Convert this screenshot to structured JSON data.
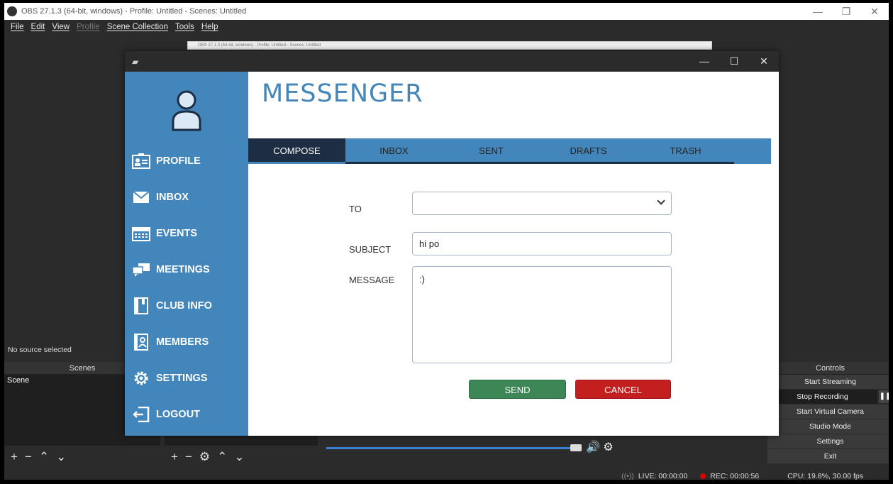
{
  "obs": {
    "title": "OBS 27.1.3 (64-bit, windows) - Profile: Untitled - Scenes: Untitled",
    "inner_title": "OBS 27.1.3 (64-bit, windows) - Profile: Untitled - Scenes: Untitled",
    "menu": [
      "File",
      "Edit",
      "View",
      "Profile",
      "Scene Collection",
      "Tools",
      "Help"
    ],
    "no_source": "No source selected",
    "scenes_header": "Scenes",
    "scene_item": "Scene",
    "controls_header": "Controls",
    "controls": [
      "Start Streaming",
      "Stop Recording",
      "Start Virtual Camera",
      "Studio Mode",
      "Settings",
      "Exit"
    ],
    "status": {
      "live": "LIVE: 00:00:00",
      "rec": "REC: 00:00:56",
      "cpu": "CPU: 19.8%, 30.00 fps"
    }
  },
  "messenger": {
    "heading": "MESSENGER",
    "nav": [
      {
        "label": "PROFILE",
        "icon": "profile-card-icon"
      },
      {
        "label": "INBOX",
        "icon": "envelope-icon"
      },
      {
        "label": "EVENTS",
        "icon": "calendar-icon"
      },
      {
        "label": "MEETINGS",
        "icon": "chat-bubbles-icon"
      },
      {
        "label": "CLUB INFO",
        "icon": "book-icon"
      },
      {
        "label": "MEMBERS",
        "icon": "contact-book-icon"
      },
      {
        "label": "SETTINGS",
        "icon": "gear-icon"
      },
      {
        "label": "LOGOUT",
        "icon": "logout-icon"
      }
    ],
    "tabs": [
      "COMPOSE",
      "INBOX",
      "SENT",
      "DRAFTS",
      "TRASH"
    ],
    "active_tab": "COMPOSE",
    "form": {
      "to_label": "TO",
      "to_value": "",
      "subject_label": "SUBJECT",
      "subject_value": "hi po",
      "message_label": "MESSAGE",
      "message_value": ":)"
    },
    "buttons": {
      "send": "SEND",
      "cancel": "CANCEL"
    },
    "colors": {
      "accent": "#4386bb",
      "tab_active": "#1d2e44",
      "send": "#3d8757",
      "cancel": "#c41f1f"
    }
  }
}
